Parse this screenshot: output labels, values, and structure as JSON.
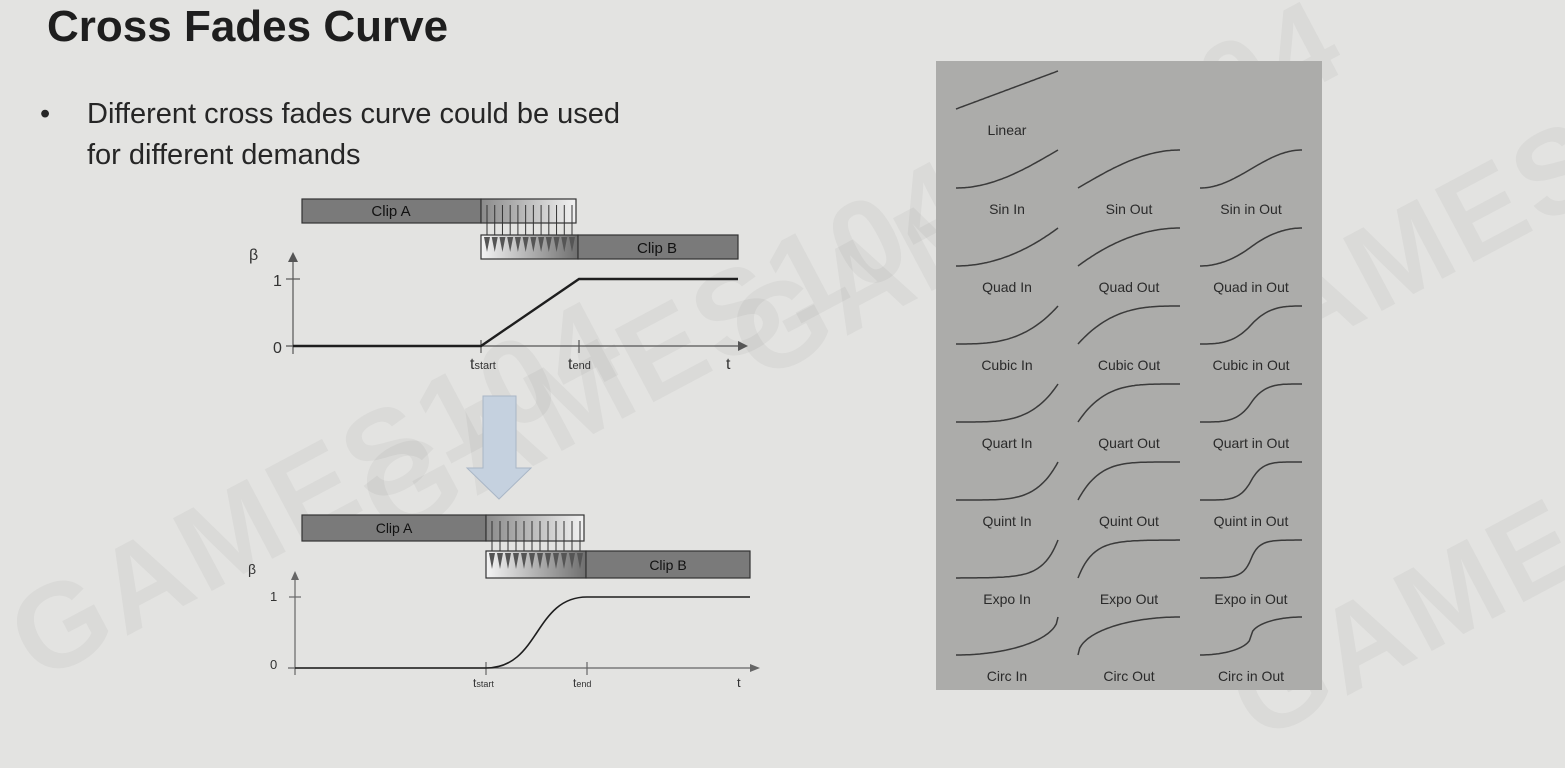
{
  "slide": {
    "title": "Cross Fades Curve",
    "bullet_marker": "•",
    "bullet_text": "Different cross fades curve could be used for different demands"
  },
  "diagram_top": {
    "clip_a": "Clip A",
    "clip_b": "Clip B",
    "y_axis_label": "β",
    "tick_1": "1",
    "tick_0": "0",
    "t_start_main": "t",
    "t_start_sub": "start",
    "t_end_main": "t",
    "t_end_sub": "end",
    "x_axis_label": "t",
    "curve": "linear"
  },
  "diagram_bottom": {
    "clip_a": "Clip A",
    "clip_b": "Clip B",
    "y_axis_label": "β",
    "tick_1": "1",
    "tick_0": "0",
    "t_start_main": "t",
    "t_start_sub": "start",
    "t_end_main": "t",
    "t_end_sub": "end",
    "x_axis_label": "t",
    "curve": "smooth"
  },
  "arrow": {
    "direction": "down",
    "color": "#c5d1df"
  },
  "curves": [
    {
      "label": "Linear",
      "fn": "linear"
    },
    {
      "label": "Sin In",
      "fn": "sinIn"
    },
    {
      "label": "Sin Out",
      "fn": "sinOut"
    },
    {
      "label": "Sin in Out",
      "fn": "sinInOut"
    },
    {
      "label": "Quad In",
      "fn": "quadIn"
    },
    {
      "label": "Quad Out",
      "fn": "quadOut"
    },
    {
      "label": "Quad in Out",
      "fn": "quadInOut"
    },
    {
      "label": "Cubic In",
      "fn": "cubicIn"
    },
    {
      "label": "Cubic Out",
      "fn": "cubicOut"
    },
    {
      "label": "Cubic in Out",
      "fn": "cubicInOut"
    },
    {
      "label": "Quart In",
      "fn": "quartIn"
    },
    {
      "label": "Quart Out",
      "fn": "quartOut"
    },
    {
      "label": "Quart in Out",
      "fn": "quartInOut"
    },
    {
      "label": "Quint In",
      "fn": "quintIn"
    },
    {
      "label": "Quint Out",
      "fn": "quintOut"
    },
    {
      "label": "Quint in Out",
      "fn": "quintInOut"
    },
    {
      "label": "Expo In",
      "fn": "expoIn"
    },
    {
      "label": "Expo Out",
      "fn": "expoOut"
    },
    {
      "label": "Expo in Out",
      "fn": "expoInOut"
    },
    {
      "label": "Circ In",
      "fn": "circIn"
    },
    {
      "label": "Circ Out",
      "fn": "circOut"
    },
    {
      "label": "Circ in Out",
      "fn": "circInOut"
    }
  ],
  "colors": {
    "background": "#e3e3e1",
    "clip_fill": "#7a7a7a",
    "panel_bg": "#acacaa",
    "curve_stroke": "#3a3a3a"
  }
}
